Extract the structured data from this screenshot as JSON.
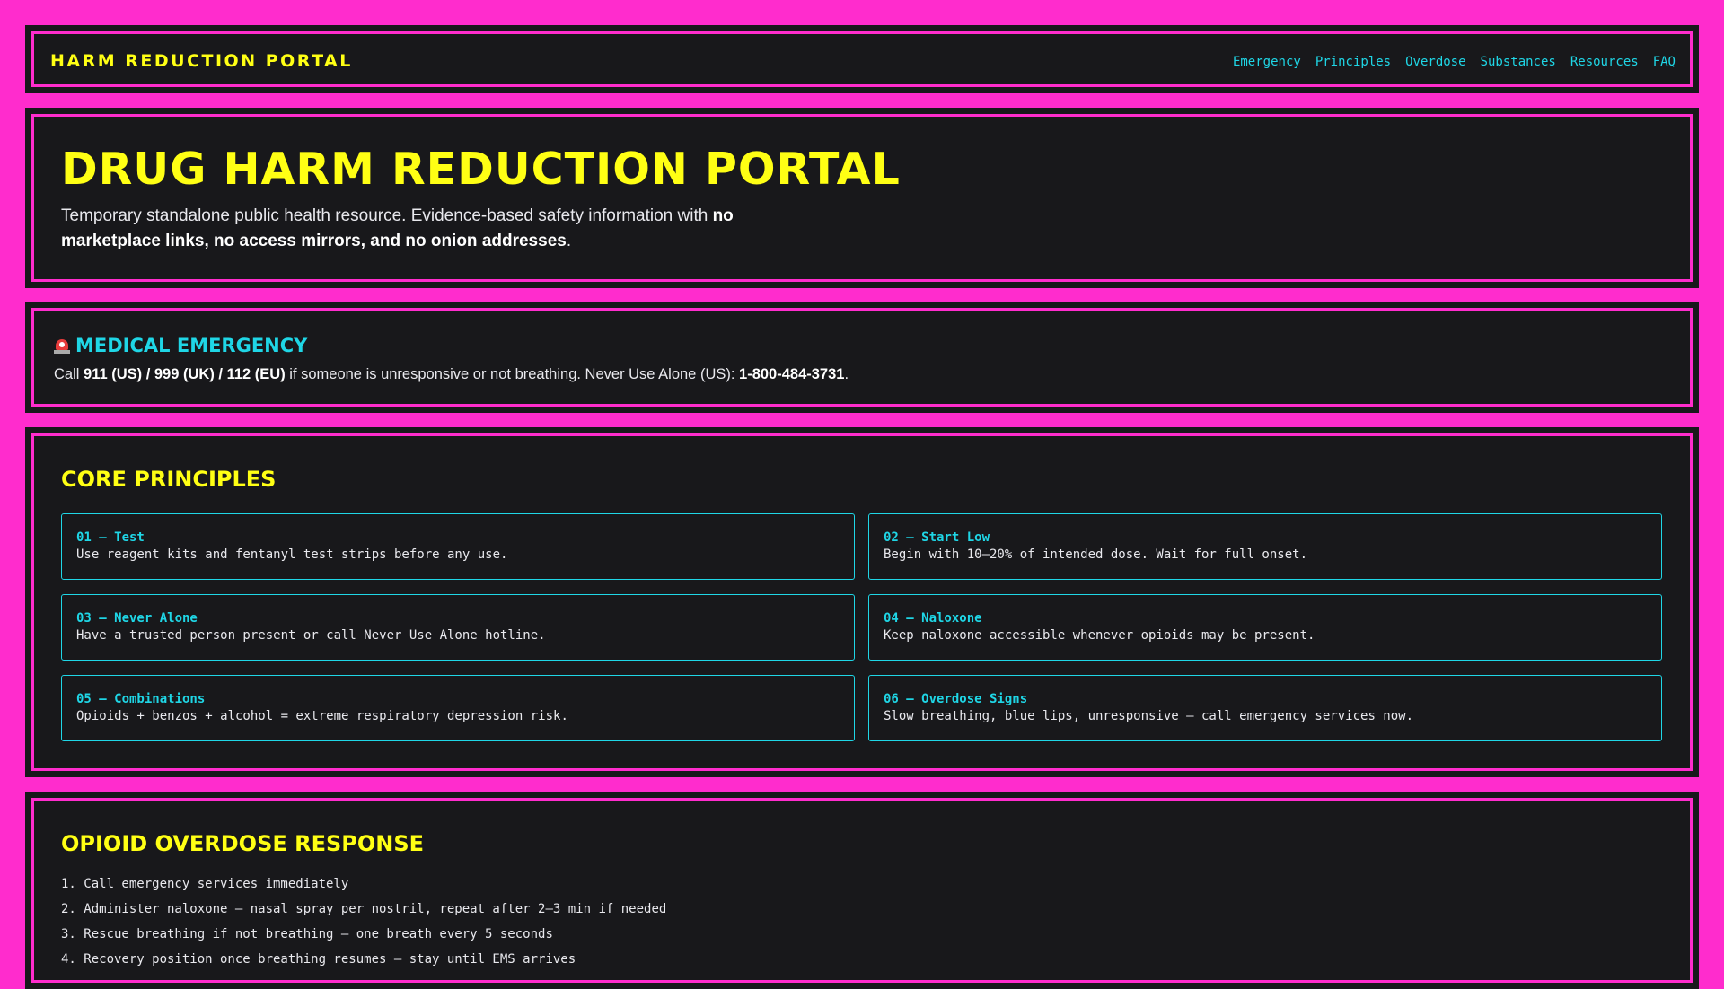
{
  "header": {
    "brand": "HARM REDUCTION PORTAL",
    "nav": [
      "Emergency",
      "Principles",
      "Overdose",
      "Substances",
      "Resources",
      "FAQ"
    ]
  },
  "hero": {
    "title": "DRUG HARM REDUCTION PORTAL",
    "subtitle_plain": "Temporary standalone public health resource. Evidence-based safety information with ",
    "subtitle_bold": "no marketplace links, no access mirrors, and no onion addresses",
    "subtitle_end": "."
  },
  "emergency": {
    "icon": "siren-icon",
    "title": "MEDICAL EMERGENCY",
    "text_pre": "Call ",
    "numbers": "911 (US) / 999 (UK) / 112 (EU)",
    "text_mid": " if someone is unresponsive or not breathing. Never Use Alone (US): ",
    "hotline": "1-800-484-3731",
    "text_end": "."
  },
  "principles": {
    "title": "CORE PRINCIPLES",
    "items": [
      {
        "title": "01 — Test",
        "desc": "Use reagent kits and fentanyl test strips before any use."
      },
      {
        "title": "02 — Start Low",
        "desc": "Begin with 10–20% of intended dose. Wait for full onset."
      },
      {
        "title": "03 — Never Alone",
        "desc": "Have a trusted person present or call Never Use Alone hotline."
      },
      {
        "title": "04 — Naloxone",
        "desc": "Keep naloxone accessible whenever opioids may be present."
      },
      {
        "title": "05 — Combinations",
        "desc": "Opioids + benzos + alcohol = extreme respiratory depression risk."
      },
      {
        "title": "06 — Overdose Signs",
        "desc": "Slow breathing, blue lips, unresponsive — call emergency services now."
      }
    ]
  },
  "overdose": {
    "title": "OPIOID OVERDOSE RESPONSE",
    "steps": [
      "1. Call emergency services immediately",
      "2. Administer naloxone — nasal spray per nostril, repeat after 2–3 min if needed",
      "3. Rescue breathing if not breathing — one breath every 5 seconds",
      "4. Recovery position once breathing resumes — stay until EMS arrives"
    ]
  },
  "colors": {
    "background": "#ff2ccd",
    "panel": "#18181b",
    "accent_yellow": "#ffff14",
    "accent_cyan": "#1fd6e6"
  }
}
